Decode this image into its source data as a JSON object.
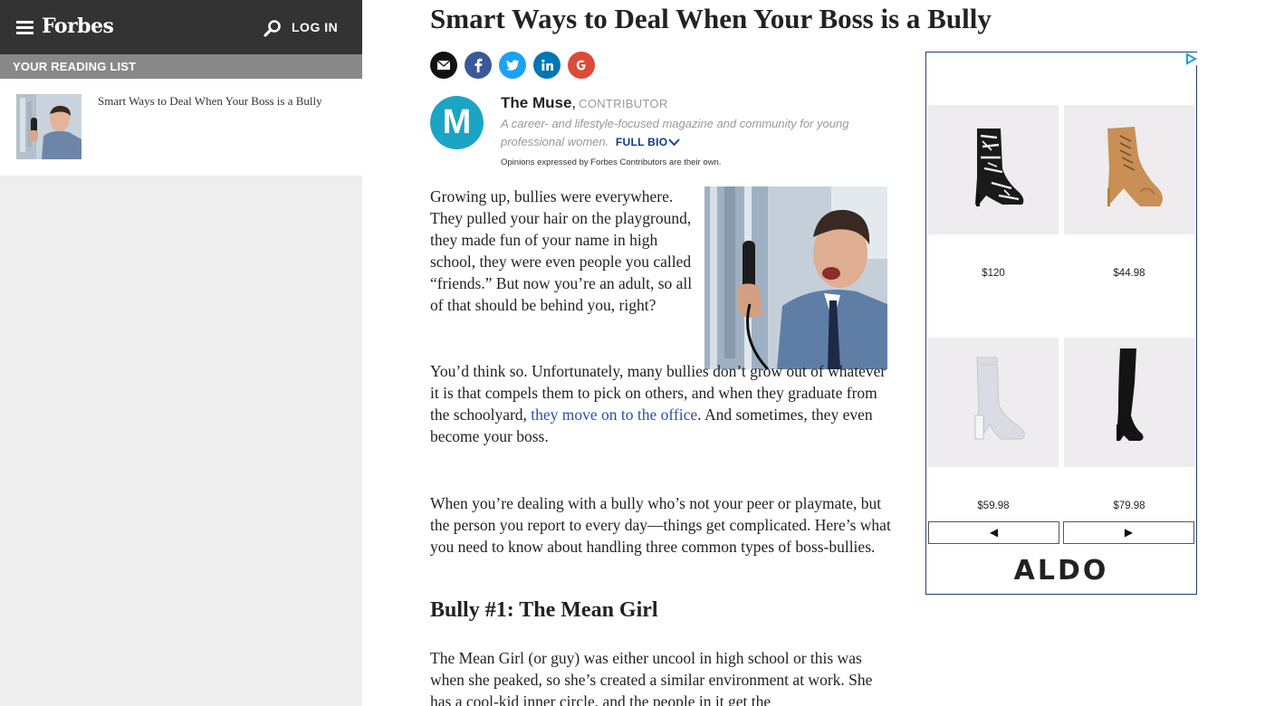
{
  "header": {
    "logo": "Forbes",
    "login_label": "LOG IN"
  },
  "reading_list": {
    "title": "YOUR READING LIST",
    "items": [
      {
        "title": "Smart Ways to Deal When Your Boss is a Bully"
      }
    ]
  },
  "article": {
    "title": "Smart Ways to Deal When Your Boss is a Bully",
    "share": {
      "email": "email-share",
      "facebook": "facebook-share",
      "twitter": "twitter-share",
      "linkedin": "linkedin-share",
      "google": "google-plus-share"
    },
    "author": {
      "initial": "M",
      "name": "The Muse",
      "separator": ",",
      "role": "CONTRIBUTOR",
      "description": "A career- and lifestyle-focused magazine and community for young professional women.",
      "full_bio_label": "FULL BIO",
      "disclaimer": "Opinions expressed by Forbes Contributors are their own."
    },
    "paragraphs": {
      "p1": "Growing up, bullies were everywhere. They pulled your hair on the playground, they made fun of your name in high school, they were even people you called “friends.” But now you’re an adult, so all of that should be behind you, right?",
      "p2_before": "You’d think so. Unfortunately, many bullies don’t grow out of whatever it is that compels them to pick on others, and when they graduate from the schoolyard, ",
      "p2_link": "they move on to the office",
      "p2_after": ". And sometimes, they even become your boss.",
      "p3": "When you’re dealing with a bully who’s not your peer or playmate, but the person you report to every day—things get complicated. Here’s what you need to know about handling three common types of boss-bullies.",
      "subhead": "Bully #1: The Mean Girl",
      "p4": "The Mean Girl (or guy) was either uncool in high school or this was when she peaked, so she’s created a similar environment at work. She has a cool-kid inner circle, and the people in it get the"
    }
  },
  "ad": {
    "products": [
      {
        "price": "$120",
        "icon": "patterned-ankle-boot"
      },
      {
        "price": "$44.98",
        "icon": "tan-lace-up-bootie"
      },
      {
        "price": "$59.98",
        "icon": "white-sock-boot"
      },
      {
        "price": "$79.98",
        "icon": "black-over-knee-boot"
      }
    ],
    "prev_label": "◀",
    "next_label": "▶",
    "brand": "ALDO"
  },
  "colors": {
    "topbar": "#333333",
    "reading_list_header": "#888888",
    "link": "#2d4fa8",
    "full_bio": "#0b3c8c",
    "avatar": "#1ba5c4",
    "ad_border": "#1f3f77"
  }
}
